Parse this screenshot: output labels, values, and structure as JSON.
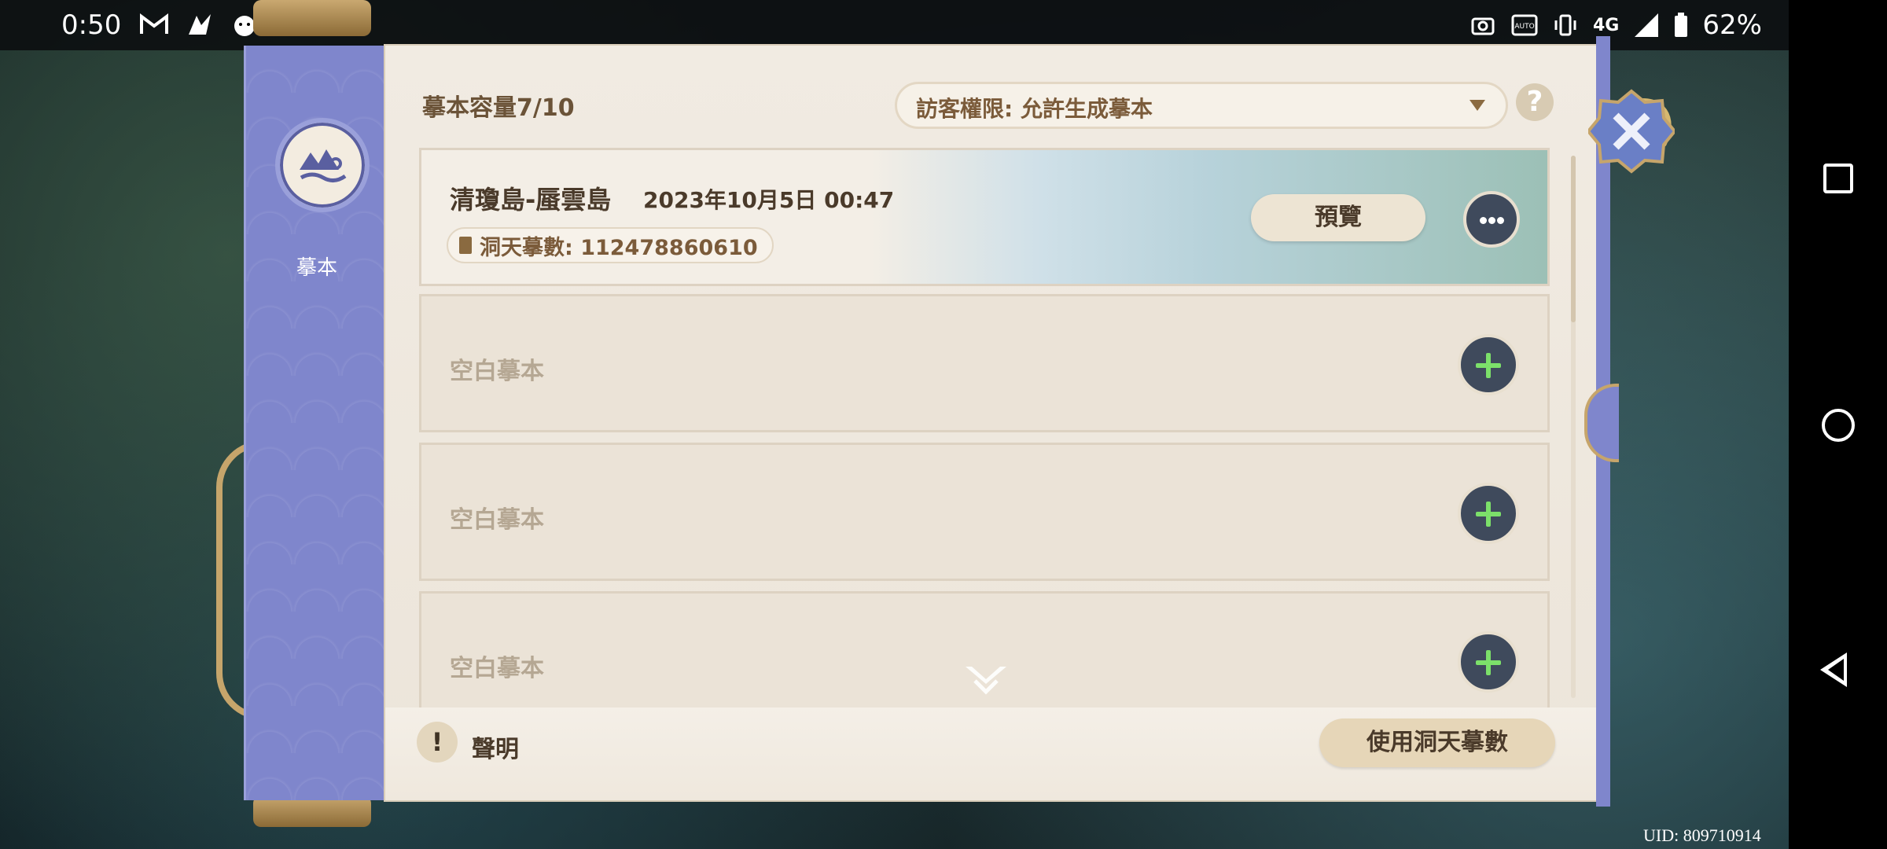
{
  "status_bar": {
    "time": "0:50",
    "left_icons": [
      "gmail-icon",
      "bird-icon",
      "chick-icon",
      "dot-icon"
    ],
    "right_icons": [
      "screenshot-icon",
      "auto-hz-icon",
      "vibrate-icon",
      "4g-icon",
      "signal-icon"
    ],
    "network": "4G",
    "battery": "62%"
  },
  "sidebar": {
    "label": "摹本",
    "icon": "mountain-cloud-emblem-icon",
    "accent": "#7f86cc"
  },
  "header": {
    "capacity": "摹本容量7/10",
    "visitor_permission": "訪客權限: 允許生成摹本",
    "help": "?"
  },
  "slots": [
    {
      "title": "清瓊島-蜃雲島",
      "date": "2023年10月5日 00:47",
      "id_label": "洞天摹數: 112478860610",
      "preview_label": "預覽"
    },
    {
      "empty_label": "空白摹本"
    },
    {
      "empty_label": "空白摹本"
    },
    {
      "empty_label": "空白摹本"
    }
  ],
  "footer": {
    "notice_icon": "!",
    "notice_label": "聲明",
    "use_button": "使用洞天摹數"
  },
  "uid": "UID: 809710914",
  "colors": {
    "panel": "#efe8dd",
    "button_dark": "#3f4a5c",
    "plus_green": "#7ce06a",
    "text_brown": "#6b5338"
  }
}
